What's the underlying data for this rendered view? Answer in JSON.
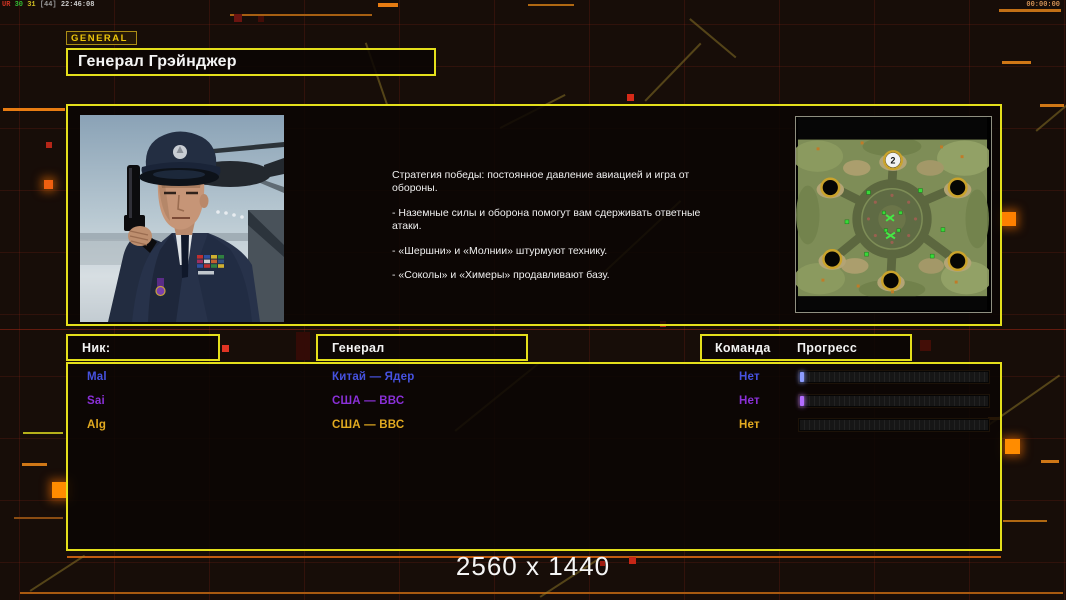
{
  "debug_overlay": {
    "segments": [
      {
        "text": "UR",
        "color": "#cc3322"
      },
      {
        "text": "30",
        "color": "#33bb33"
      },
      {
        "text": "31",
        "color": "#ccbb22"
      },
      {
        "text": "[44]",
        "color": "#999999"
      },
      {
        "text": "22:46:08",
        "color": "#cccccc"
      }
    ]
  },
  "match_timer": {
    "value": "00:00:00"
  },
  "general_tab": {
    "label": "GENERAL"
  },
  "title_box": {
    "title": "Генерал Грэйнджер"
  },
  "briefing": {
    "strategy_paragraphs": [
      "Стратегия победы: постоянное давление авиацией и игра от обороны.",
      "- Наземные силы и оборона помогут вам сдерживать ответные атаки.",
      "- «Шершни» и «Молнии» штурмуют технику.",
      "- «Соколы» и «Химеры» продавливают базу."
    ],
    "minimap": {
      "player_marker": "2"
    }
  },
  "lobby": {
    "headers": {
      "nick": "Ник:",
      "general": "Генерал",
      "team": "Команда",
      "progress": "Прогресс"
    },
    "rows": [
      {
        "nick": "Mal",
        "general": "Китай — Ядер",
        "team": "Нет",
        "progress_percent": 2,
        "color": "#4652e0",
        "fill_color": "#8c9cff"
      },
      {
        "nick": "Sai",
        "general": "США — ВВС",
        "team": "Нет",
        "progress_percent": 2,
        "color": "#8a30d8",
        "fill_color": "#b36cff"
      },
      {
        "nick": "Alg",
        "general": "США — ВВС",
        "team": "Нет",
        "progress_percent": 0,
        "color": "#e2aa20",
        "fill_color": "#ffd24a"
      }
    ]
  },
  "footer": {
    "resolution_label": "2560 x 1440"
  },
  "theme": {
    "panel_border": "#e4df1b",
    "accent_orange": "#ff8a00",
    "alert_red": "#cc2818"
  }
}
